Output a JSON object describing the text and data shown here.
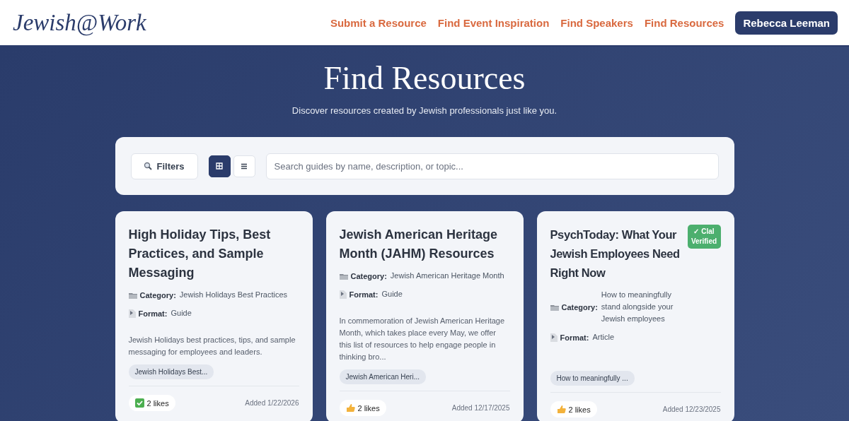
{
  "header": {
    "logo": "Jewish@Work",
    "nav": [
      "Submit a Resource",
      "Find Event Inspiration",
      "Find Speakers",
      "Find Resources"
    ],
    "user_button": "Rebecca Leeman"
  },
  "hero": {
    "title": "Find Resources",
    "subtitle": "Discover resources created by Jewish professionals just like you."
  },
  "toolbar": {
    "filters_button": "Filters",
    "views": [
      {
        "kind": "grid",
        "selected": true
      },
      {
        "kind": "list",
        "selected": false
      }
    ],
    "search": {
      "placeholder": "Search guides by name, description, or topic..."
    }
  },
  "cards": [
    {
      "title": "High Holiday Tips, Best Practices, and Sample Messaging",
      "category_label": "Category:",
      "category": "Jewish Holidays Best Practices",
      "format_label": "Format:",
      "format": "Guide",
      "description": "Jewish Holidays best practices, tips, and sample messaging for employees and leaders.",
      "tag": "Jewish Holidays Best...",
      "likes": {
        "kind": "check",
        "label": "2 likes"
      },
      "added": "Added 1/22/2026"
    },
    {
      "title": "Jewish American Heritage Month (JAHM) Resources",
      "category_label": "Category:",
      "category": "Jewish American Heritage Month",
      "format_label": "Format:",
      "format": "Guide",
      "description": "In commemoration of Jewish American Heritage Month, which takes place every May, we offer this list of resources to help engage people in thinking bro...",
      "tag": "Jewish American Heri...",
      "likes": {
        "kind": "thumb",
        "label": "2 likes"
      },
      "added": "Added 12/17/2025"
    },
    {
      "title": "PsychToday: What Your Jewish Employees Need Right Now",
      "badge": "✓ Clal Verified",
      "category_label": "Category:",
      "category": "How to meaningfully stand alongside your Jewish employees",
      "format_label": "Format:",
      "format": "Article",
      "tag": "How to meaningfully ...",
      "likes": {
        "kind": "thumb",
        "label": "2 likes"
      },
      "added": "Added 12/23/2025"
    }
  ]
}
